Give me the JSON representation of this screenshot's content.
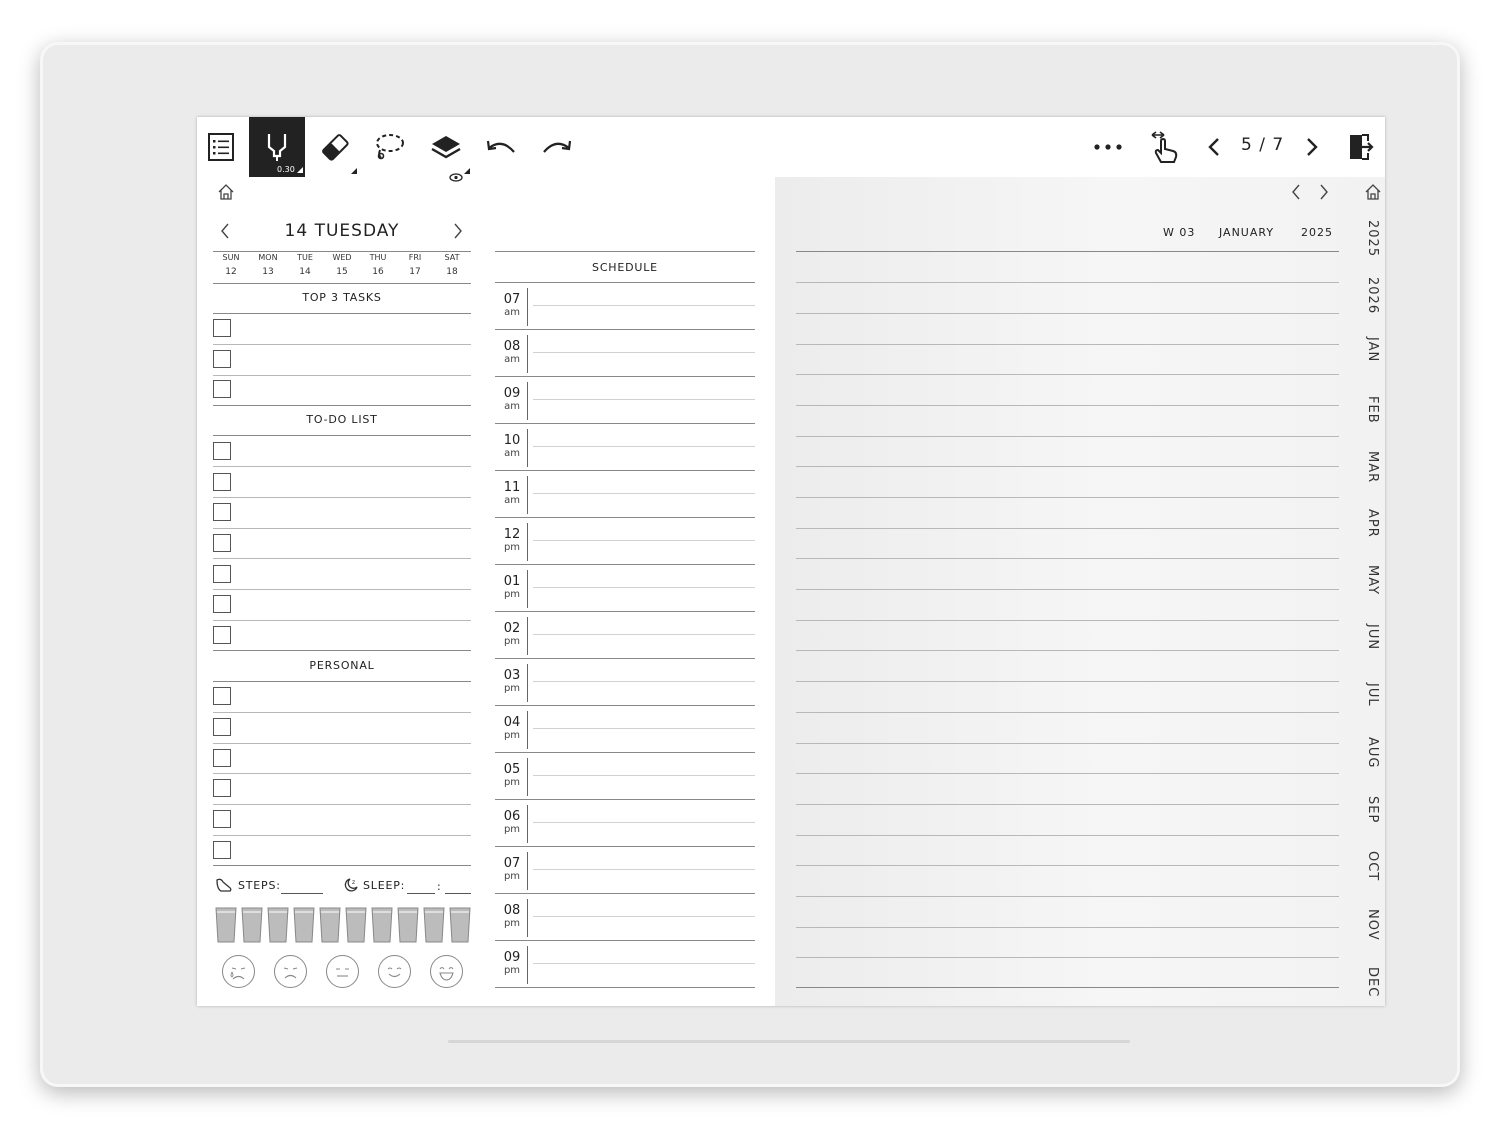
{
  "toolbar": {
    "pen_size": "0.30",
    "page_counter": "5 / 7"
  },
  "day_view": {
    "date_title": "14 TUESDAY",
    "weekdays": [
      {
        "name": "SUN",
        "num": "12"
      },
      {
        "name": "MON",
        "num": "13"
      },
      {
        "name": "TUE",
        "num": "14"
      },
      {
        "name": "WED",
        "num": "15"
      },
      {
        "name": "THU",
        "num": "16"
      },
      {
        "name": "FRI",
        "num": "17"
      },
      {
        "name": "SAT",
        "num": "18"
      }
    ],
    "top_tasks_title": "TOP 3 TASKS",
    "todo_title": "TO-DO LIST",
    "personal_title": "PERSONAL",
    "steps_label": "STEPS:",
    "sleep_label": "SLEEP:",
    "sleep_sep": ":"
  },
  "schedule": {
    "title": "SCHEDULE",
    "slots": [
      {
        "hour": "07",
        "ampm": "am"
      },
      {
        "hour": "08",
        "ampm": "am"
      },
      {
        "hour": "09",
        "ampm": "am"
      },
      {
        "hour": "10",
        "ampm": "am"
      },
      {
        "hour": "11",
        "ampm": "am"
      },
      {
        "hour": "12",
        "ampm": "pm"
      },
      {
        "hour": "01",
        "ampm": "pm"
      },
      {
        "hour": "02",
        "ampm": "pm"
      },
      {
        "hour": "03",
        "ampm": "pm"
      },
      {
        "hour": "04",
        "ampm": "pm"
      },
      {
        "hour": "05",
        "ampm": "pm"
      },
      {
        "hour": "06",
        "ampm": "pm"
      },
      {
        "hour": "07",
        "ampm": "pm"
      },
      {
        "hour": "08",
        "ampm": "pm"
      },
      {
        "hour": "09",
        "ampm": "pm"
      }
    ]
  },
  "notes": {
    "week": "W 03",
    "month": "JANUARY",
    "year": "2025"
  },
  "side_tabs": [
    "2025",
    "2026",
    "JAN",
    "FEB",
    "MAR",
    "APR",
    "MAY",
    "JUN",
    "JUL",
    "AUG",
    "SEP",
    "OCT",
    "NOV",
    "DEC"
  ]
}
